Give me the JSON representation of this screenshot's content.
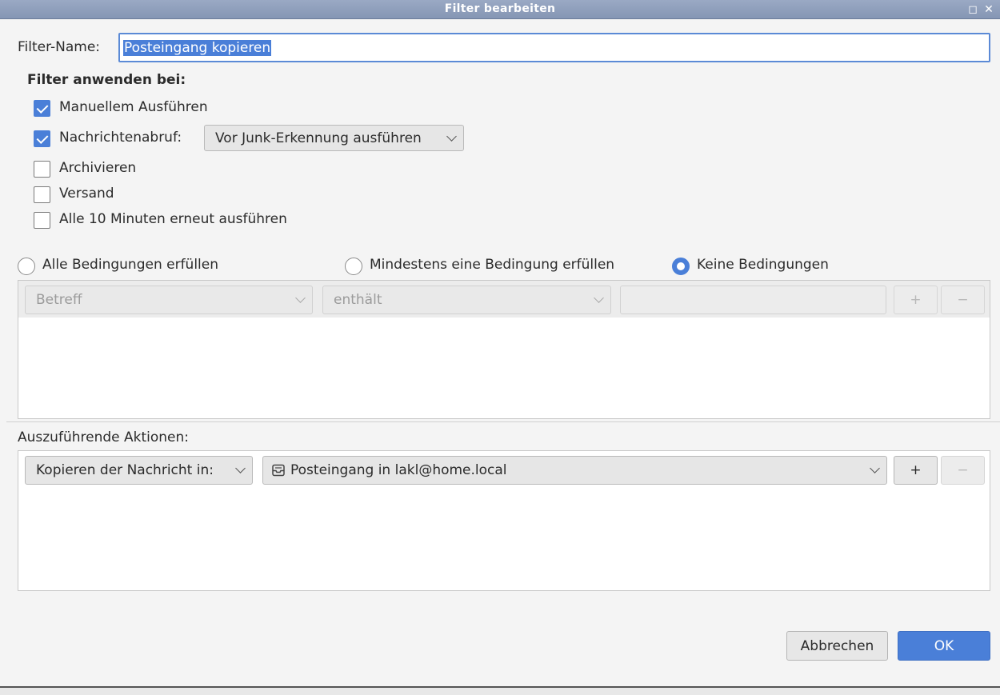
{
  "window": {
    "title": "Filter bearbeiten"
  },
  "filter_name": {
    "label": "Filter-Name:",
    "value": "Posteingang kopieren"
  },
  "apply_when": {
    "heading": "Filter anwenden bei:",
    "manual": {
      "label": "Manuellem Ausführen",
      "checked": true
    },
    "fetch": {
      "label": "Nachrichtenabruf:",
      "checked": true,
      "option": "Vor Junk-Erkennung ausführen"
    },
    "archive": {
      "label": "Archivieren",
      "checked": false
    },
    "send": {
      "label": "Versand",
      "checked": false
    },
    "periodic": {
      "label": "Alle 10 Minuten erneut ausführen",
      "checked": false
    }
  },
  "match": {
    "all": "Alle Bedingungen erfüllen",
    "any": "Mindestens eine Bedingung erfüllen",
    "none": "Keine Bedingungen",
    "selected": "none"
  },
  "condition_row": {
    "field": "Betreff",
    "operator": "enthält",
    "value": "",
    "add": "+",
    "remove": "−"
  },
  "actions": {
    "heading": "Auszuführende Aktionen:",
    "action": "Kopieren der Nachricht in:",
    "target": "Posteingang in lakl@home.local",
    "add": "+",
    "remove": "−"
  },
  "buttons": {
    "cancel": "Abbrechen",
    "ok": "OK"
  },
  "colors": {
    "accent": "#4a7fd8",
    "titlebar": "#8e9fbc"
  }
}
